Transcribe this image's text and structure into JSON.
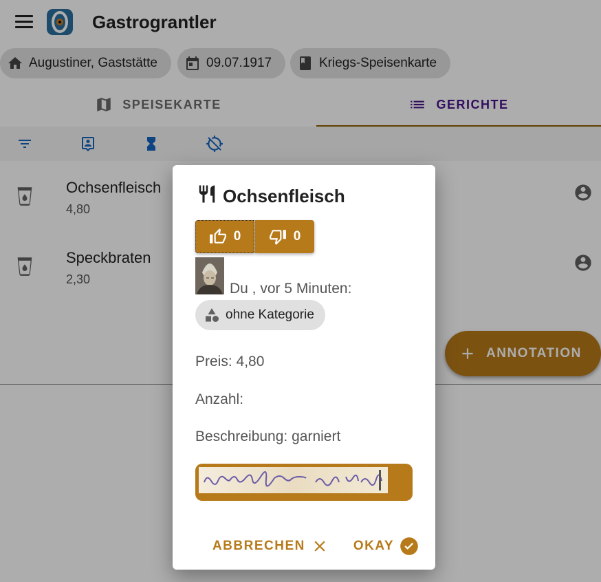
{
  "app": {
    "title": "Gastrograntler"
  },
  "breadcrumbs": [
    {
      "label": "Augustiner, Gaststätte",
      "icon": "home-icon"
    },
    {
      "label": "09.07.1917",
      "icon": "calendar-icon"
    },
    {
      "label": "Kriegs-Speisenkarte",
      "icon": "book-icon"
    }
  ],
  "tabs": [
    {
      "label": "SPEISEKARTE",
      "icon": "map-icon",
      "active": false
    },
    {
      "label": "GERICHTE",
      "icon": "list-icon",
      "active": true
    }
  ],
  "filters": [
    "filter-icon",
    "portrait-icon",
    "hourglass-icon",
    "location-off-icon"
  ],
  "dishes": [
    {
      "name": "Ochsenfleisch",
      "price": "4,80"
    },
    {
      "name": "Speckbraten",
      "price": "2,30"
    }
  ],
  "fab": {
    "label": "ANNOTATION"
  },
  "dialog": {
    "title": "Ochsenfleisch",
    "upvotes": "0",
    "downvotes": "0",
    "meta": "Du , vor 5 Minuten:",
    "category": "ohne Kategorie",
    "price": "Preis: 4,80",
    "count": "Anzahl:",
    "description": "Beschreibung: garniert",
    "cancel_label": "ABBRECHEN",
    "ok_label": "OKAY"
  },
  "colors": {
    "accent": "#b77a1a",
    "active_tab": "#4a148c",
    "indicator": "#8d5c00"
  }
}
